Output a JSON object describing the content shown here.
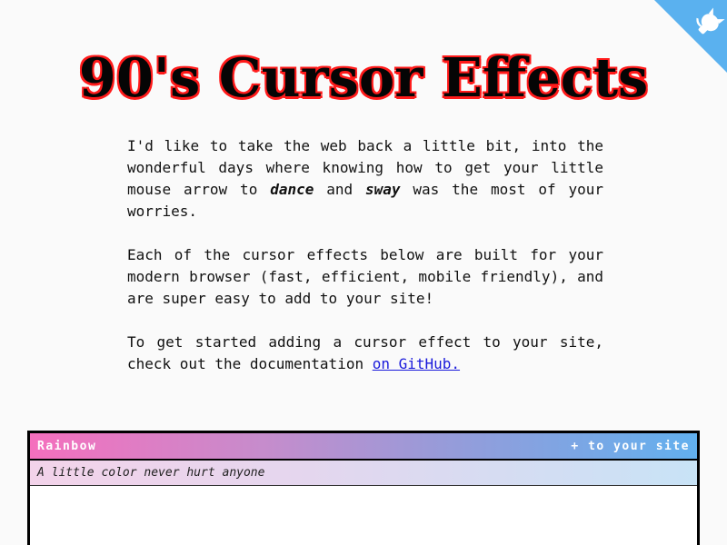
{
  "header": {
    "title": "90's Cursor Effects"
  },
  "intro": {
    "p1_before": "I'd like to take the web back a little bit, into the wonderful days where knowing how to get your little mouse arrow to ",
    "p1_em1": "dance",
    "p1_and": " and ",
    "p1_em2": "sway",
    "p1_after": " was the most of your worries.",
    "p2": "Each of the cursor effects below are built for your modern browser (fast, efficient, mobile friendly), and are super easy to add to your site!",
    "p3_before": "To get started adding a cursor effect to your site, check out the documentation ",
    "p3_link": "on GitHub."
  },
  "github_corner": {
    "icon": "github-octocat-icon",
    "color": "#5ab1ef"
  },
  "effects": [
    {
      "name": "Rainbow",
      "add_label": "+ to your site",
      "description": "A little color never hurt anyone"
    }
  ],
  "colors": {
    "title_outline": "#ff1a1a",
    "link": "#1a1adb",
    "corner": "#5ab1ef"
  }
}
